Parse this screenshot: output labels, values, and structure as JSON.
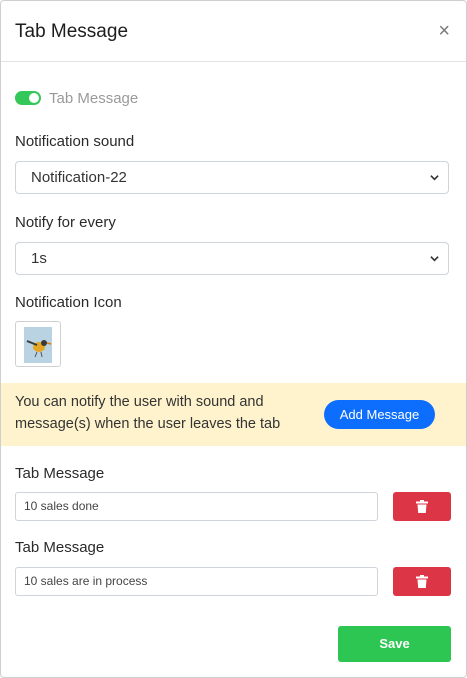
{
  "modal": {
    "title": "Tab Message",
    "close_symbol": "×"
  },
  "toggle": {
    "label": "Tab Message",
    "enabled": true
  },
  "notification_sound": {
    "label": "Notification sound",
    "value": "Notification-22"
  },
  "notify_every": {
    "label": "Notify for every",
    "value": "1s"
  },
  "notification_icon": {
    "label": "Notification Icon",
    "icon": "bird-icon"
  },
  "banner": {
    "text": "You can notify the user with sound and message(s) when the user leaves the tab",
    "button_label": "Add Message"
  },
  "messages": [
    {
      "label": "Tab Message",
      "value": "10 sales done"
    },
    {
      "label": "Tab Message",
      "value": "10 sales are in process"
    }
  ],
  "footer": {
    "save_label": "Save"
  },
  "colors": {
    "accent": "#0d6efd",
    "danger": "#dc3545",
    "success": "#2dc653",
    "toggle": "#34c759",
    "banner_bg": "#fff3cd"
  }
}
